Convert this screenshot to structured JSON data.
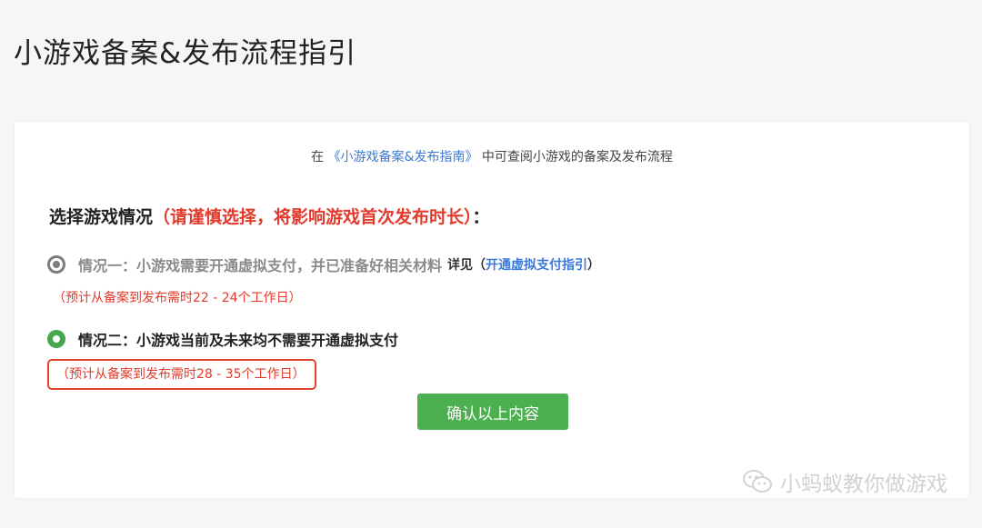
{
  "page": {
    "title": "小游戏备案&发布流程指引"
  },
  "intro": {
    "prefix": "在",
    "link": "《小游戏备案&发布指南》",
    "suffix": "中可查阅小游戏的备案及发布流程"
  },
  "selection": {
    "title": "选择游戏情况",
    "warning": "（请谨慎选择，将影响游戏首次发布时长）",
    "colon": "："
  },
  "options": [
    {
      "label": "情况一：小游戏需要开通虚拟支付，并已准备好相关材料",
      "detail_prefix": "详见（",
      "detail_link": "开通虚拟支付指引",
      "detail_suffix": "）",
      "estimate": "（预计从备案到发布需时22 - 24个工作日）",
      "selected": false
    },
    {
      "label": "情况二：小游戏当前及未来均不需要开通虚拟支付",
      "estimate": "（预计从备案到发布需时28 - 35个工作日）",
      "selected": true
    }
  ],
  "confirm_button": "确认以上内容",
  "watermark": {
    "text": "小蚂蚁教你做游戏",
    "icon": "wechat-icon"
  },
  "colors": {
    "accent_green": "#4caf50",
    "warning_red": "#e23a2c",
    "link_blue": "#3b78d8"
  }
}
